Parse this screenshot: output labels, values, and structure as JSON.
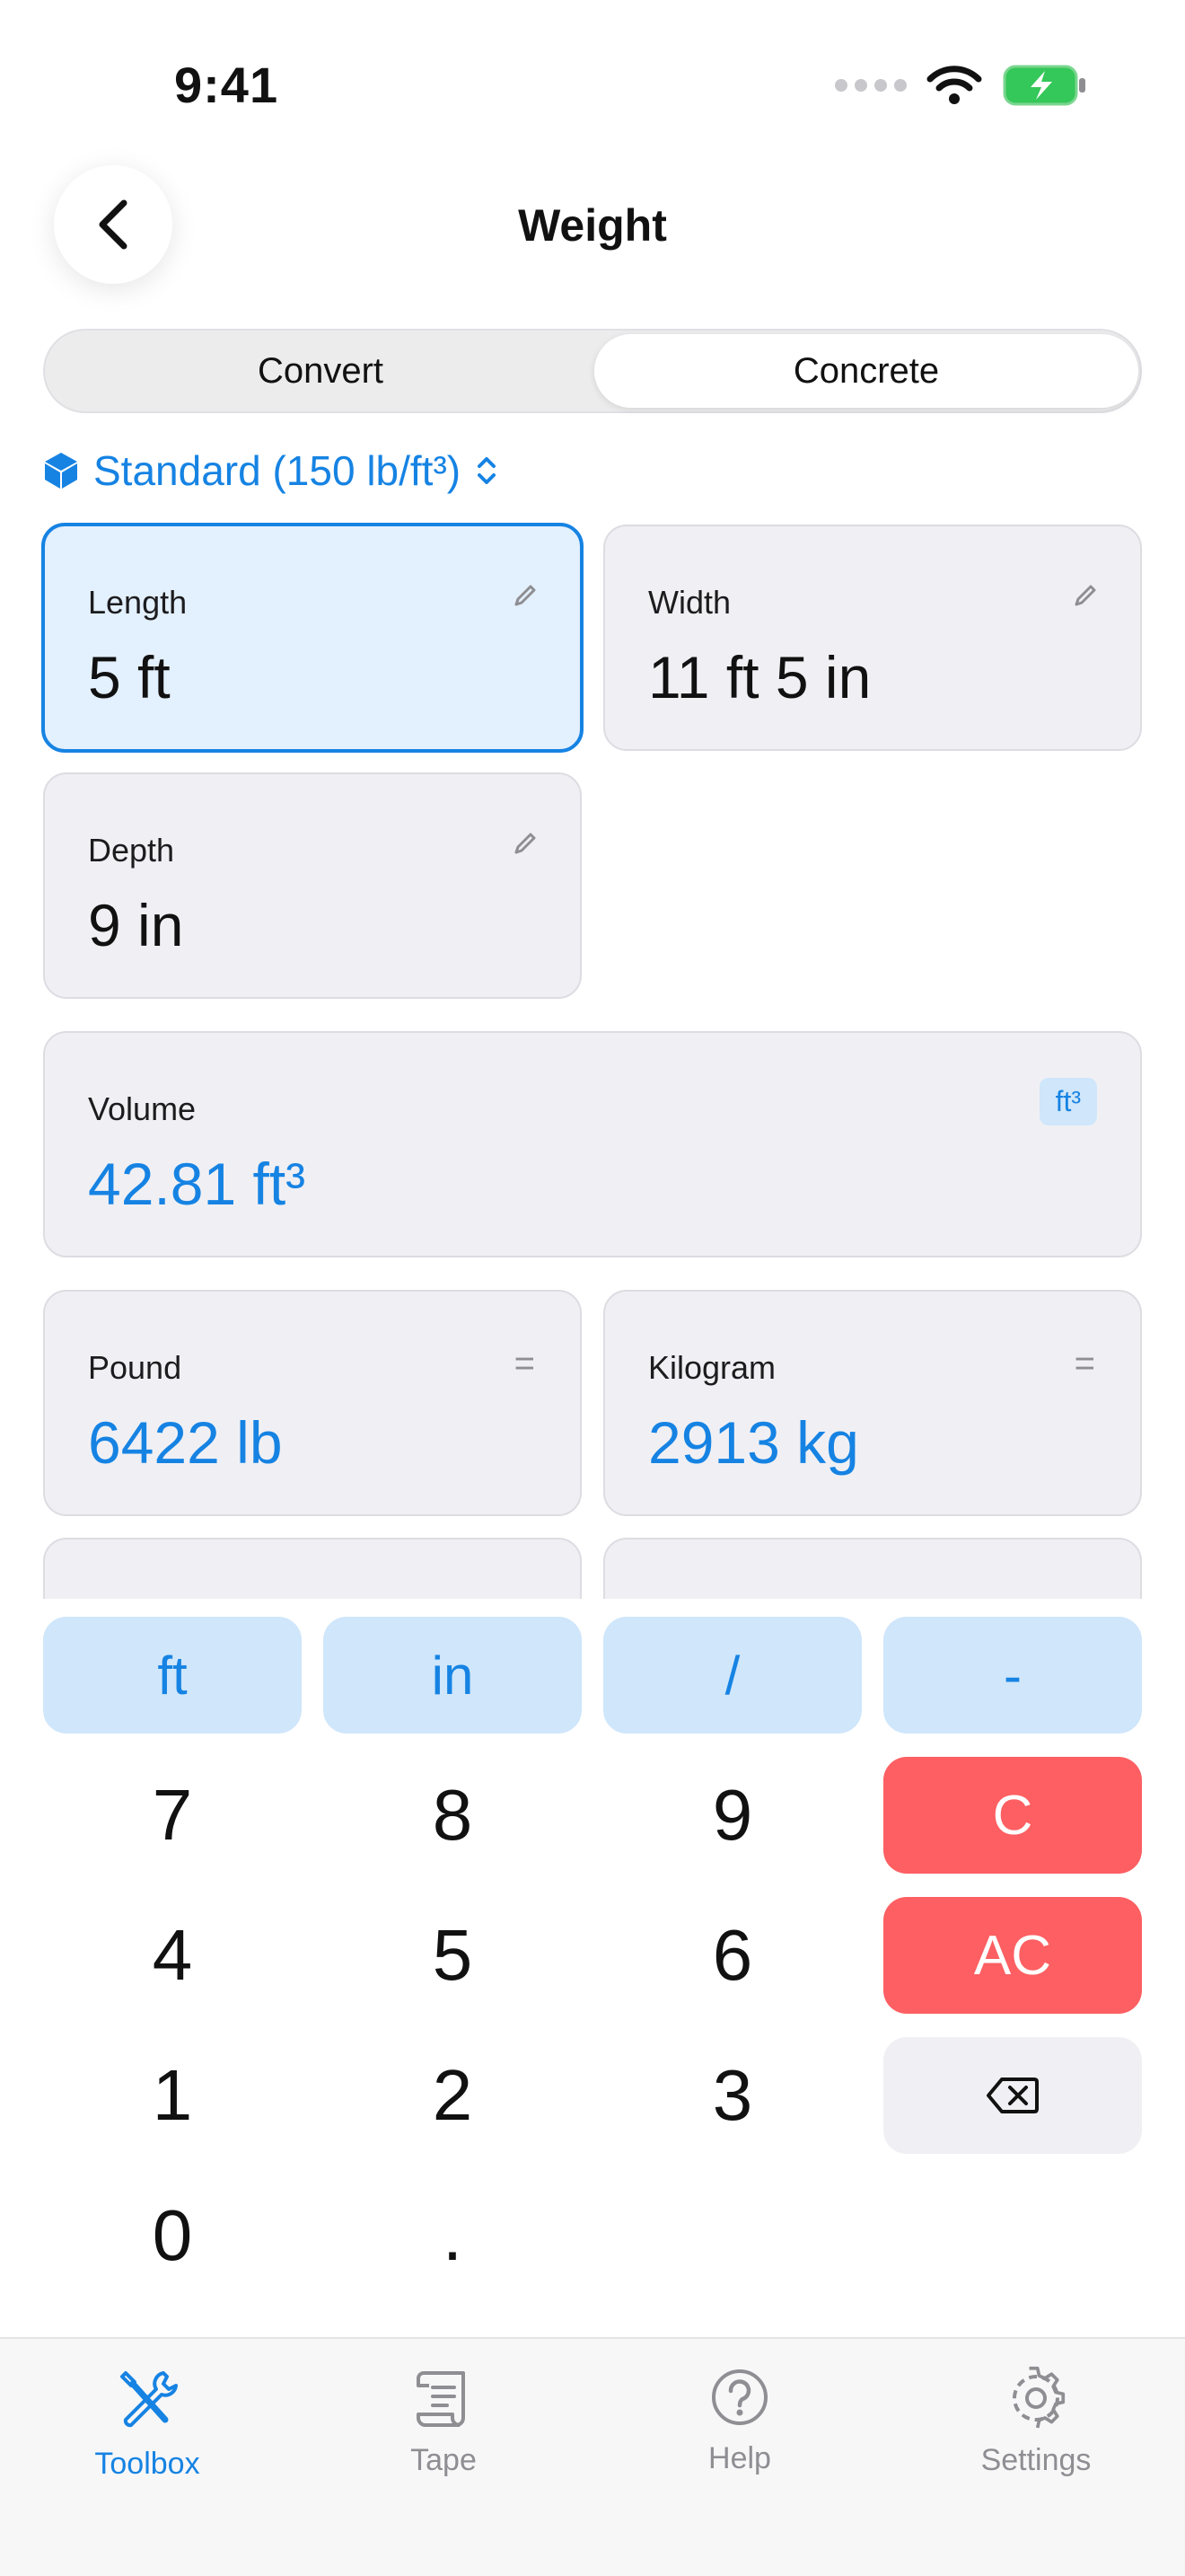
{
  "status_bar": {
    "time": "9:41"
  },
  "header": {
    "title": "Weight"
  },
  "segmented": {
    "convert_label": "Convert",
    "concrete_label": "Concrete"
  },
  "mix": {
    "label": "Standard (150 lb/ft³)"
  },
  "fields": {
    "length": {
      "label": "Length",
      "value": "5 ft"
    },
    "width": {
      "label": "Width",
      "value": "11 ft 5 in"
    },
    "depth": {
      "label": "Depth",
      "value": "9 in"
    }
  },
  "results": {
    "volume": {
      "label": "Volume",
      "value": "42.81 ft³",
      "unit_badge": "ft³"
    },
    "pound": {
      "label": "Pound",
      "value": "6422 lb"
    },
    "kilogram": {
      "label": "Kilogram",
      "value": "2913 kg"
    }
  },
  "keypad": {
    "top_row": [
      "ft",
      "in",
      "/",
      "-"
    ],
    "digits": [
      "7",
      "8",
      "9",
      "4",
      "5",
      "6",
      "1",
      "2",
      "3",
      "0",
      "."
    ],
    "clear_label": "C",
    "all_clear_label": "AC"
  },
  "tabs": [
    {
      "label": "Toolbox",
      "icon": "tools-icon"
    },
    {
      "label": "Tape",
      "icon": "scroll-icon"
    },
    {
      "label": "Help",
      "icon": "question-circle-icon"
    },
    {
      "label": "Settings",
      "icon": "gear-icon"
    }
  ],
  "colors": {
    "accent": "#1683e3",
    "destructive": "#fd5f62",
    "card_bg": "#f0f0f4",
    "active_card_bg": "#e3f0fd",
    "battery_green": "#34c759"
  }
}
